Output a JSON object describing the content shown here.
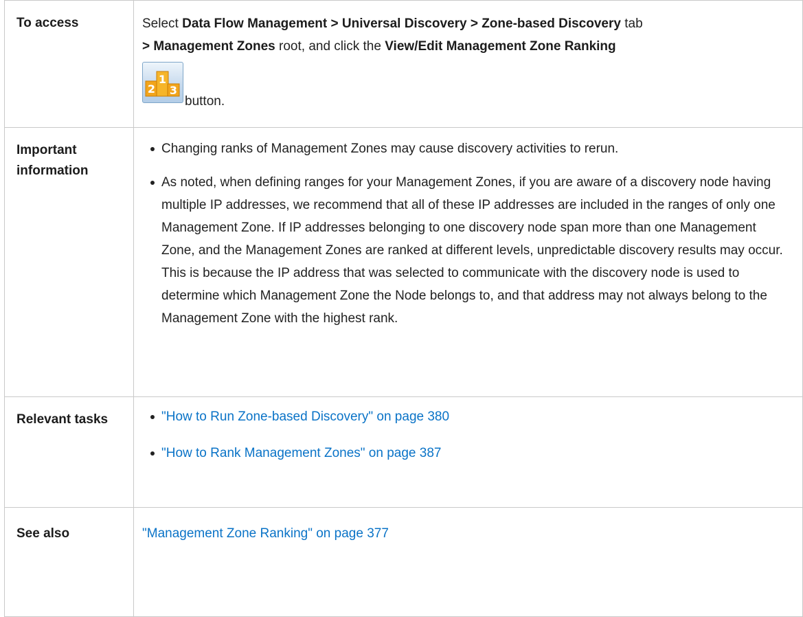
{
  "rows": {
    "access": {
      "header": "To access",
      "select_text": "Select ",
      "path_a": "Data Flow Management > Universal Discovery > Zone-based Discovery",
      "tab_text": " tab",
      "path_b": "> Management Zones",
      "root_text": " root, and click the ",
      "button_name": "View/Edit Management Zone Ranking",
      "button_suffix": " button."
    },
    "important": {
      "header": "Important information",
      "bullets": [
        "Changing ranks of Management Zones may cause discovery activities to rerun.",
        "As noted, when defining ranges for your Management Zones, if you are aware of a discovery node having multiple IP addresses, we recommend that all of these IP addresses are included in the ranges of only one Management Zone. If IP addresses belonging to one discovery node span more than one Management Zone, and the Management Zones are ranked at different levels, unpredictable discovery results may occur. This is because the IP address that was selected to communicate with the discovery node is used to determine which Management Zone the Node belongs to, and that address may not always belong to the Management Zone with the highest rank."
      ]
    },
    "tasks": {
      "header": "Relevant tasks",
      "links": [
        "\"How to Run Zone-based Discovery\" on page 380",
        "\"How to Rank Management Zones\" on page 387"
      ]
    },
    "see_also": {
      "header": "See also",
      "link": "\"Management Zone Ranking\" on page 377"
    }
  },
  "icon": {
    "name": "ranking-icon",
    "digits": [
      "2",
      "1",
      "3"
    ],
    "colors": {
      "podium": "#f2a51c",
      "digit": "#ffffff",
      "button_bg": "#c8dbee"
    }
  }
}
